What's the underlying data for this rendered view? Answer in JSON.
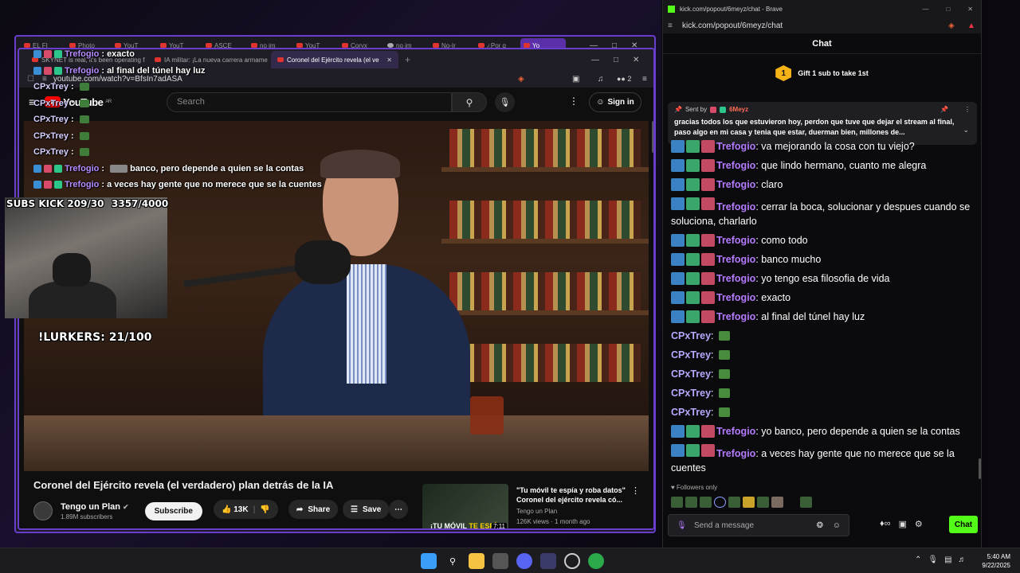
{
  "back_window": {
    "tabs": [
      "EL FI",
      "Photo",
      "YouT",
      "YouT",
      "ASCE",
      "no im",
      "YouT",
      "Coryx",
      "no im",
      "No-Ir",
      "¿Por q",
      "Yo"
    ]
  },
  "front_window": {
    "tabs": [
      {
        "label": "SKYNET is real, it's been operating fo"
      },
      {
        "label": "IA militar: ¡La nueva carrera armame"
      },
      {
        "label": "Coronel del Ejército revela (el ve"
      }
    ],
    "url": "youtube.com/watch?v=BfsIn7adASA",
    "brave_count": "2"
  },
  "youtube": {
    "logo_text": "YouTube",
    "region": "AR",
    "search_placeholder": "Search",
    "signin_label": "Sign in",
    "video_title": "Coronel del Ejército revela (el verdadero) plan detrás de la IA",
    "channel_name": "Tengo un Plan",
    "subscribers": "1.89M subscribers",
    "subscribe_label": "Subscribe",
    "likes": "13K",
    "share_label": "Share",
    "save_label": "Save",
    "recommended": {
      "title": "\"Tu móvil te espía y roba datos\" Coronel del ejército revela có...",
      "channel": "Tengo un Plan",
      "meta": "126K views · 1 month ago",
      "thumb_text_a": "¡TU MÓVIL ",
      "thumb_text_b": "TE ESPÍA!",
      "duration": "7:11"
    }
  },
  "stream_overlay": {
    "subs_kick": "SUBS KICK 209/30",
    "goal": "3357/4000",
    "lurkers": "!LURKERS: 21/100",
    "chat": [
      {
        "user": "Trefogio",
        "text": "exacto",
        "badges": true
      },
      {
        "user": "Trefogio",
        "text": "al final del túnel hay luz",
        "badges": true
      },
      {
        "user": "CPxTrey",
        "text": "",
        "emote": true
      },
      {
        "user": "CPxTrey",
        "text": "",
        "emote": true
      },
      {
        "user": "CPxTrey",
        "text": "",
        "emote": true
      },
      {
        "user": "CPxTrey",
        "text": "",
        "emote": true
      },
      {
        "user": "CPxTrey",
        "text": "",
        "emote": true
      },
      {
        "user": "Trefogio",
        "text": "banco, pero depende a quien se la contas",
        "badges": true,
        "inline_emote": true
      },
      {
        "user": "Trefogio",
        "text": "a veces hay gente que no merece que se la cuentes",
        "badges": true
      }
    ]
  },
  "kick": {
    "window_title": "kick.com/popout/6meyz/chat - Brave",
    "url": "kick.com/popout/6meyz/chat",
    "header": "Chat",
    "gift_rank": "1",
    "gift_text": "Gift 1 sub to take 1st",
    "pinned": {
      "sent_by": "Sent by",
      "sender": "6Meyz",
      "message": "gracias todos los que estuvieron hoy, perdon que tuve que dejar el stream al final, paso algo en mi casa y tenia que estar, duerman bien, millones de..."
    },
    "messages": [
      {
        "user": "Trefogio",
        "text": "va mejorando la cosa con tu viejo?",
        "badges": true
      },
      {
        "user": "Trefogio",
        "text": "que lindo hermano, cuanto me alegra",
        "badges": true
      },
      {
        "user": "Trefogio",
        "text": "claro",
        "badges": true
      },
      {
        "user": "Trefogio",
        "text": "cerrar la boca, solucionar y despues cuando se soluciona, charlarlo",
        "badges": true
      },
      {
        "user": "Trefogio",
        "text": "como todo",
        "badges": true
      },
      {
        "user": "Trefogio",
        "text": "banco mucho",
        "badges": true
      },
      {
        "user": "Trefogio",
        "text": "yo tengo esa filosofia de vida",
        "badges": true
      },
      {
        "user": "Trefogio",
        "text": "exacto",
        "badges": true
      },
      {
        "user": "Trefogio",
        "text": "al final del túnel hay luz",
        "badges": true
      },
      {
        "user": "CPxTrey",
        "text": "",
        "emote": true
      },
      {
        "user": "CPxTrey",
        "text": "",
        "emote": true
      },
      {
        "user": "CPxTrey",
        "text": "",
        "emote": true
      },
      {
        "user": "CPxTrey",
        "text": "",
        "emote": true
      },
      {
        "user": "CPxTrey",
        "text": "",
        "emote": true
      },
      {
        "user": "Trefogio",
        "text": "yo banco, pero depende a quien se la contas",
        "badges": true
      },
      {
        "user": "Trefogio",
        "text": "a veces hay gente que no merece que se la cuentes",
        "badges": true
      }
    ],
    "followers_only": "Followers only",
    "input_placeholder": "Send a message",
    "chat_button": "Chat"
  },
  "taskbar": {
    "time": "5:40 AM",
    "date": "9/22/2025",
    "icons": [
      "windows-start",
      "search",
      "file-explorer",
      "store",
      "discord",
      "brave",
      "chrome",
      "xbox"
    ]
  },
  "colors": {
    "kick_green": "#53fc18",
    "window_border": "#6a3ecc",
    "username_purple": "#b57bff"
  }
}
